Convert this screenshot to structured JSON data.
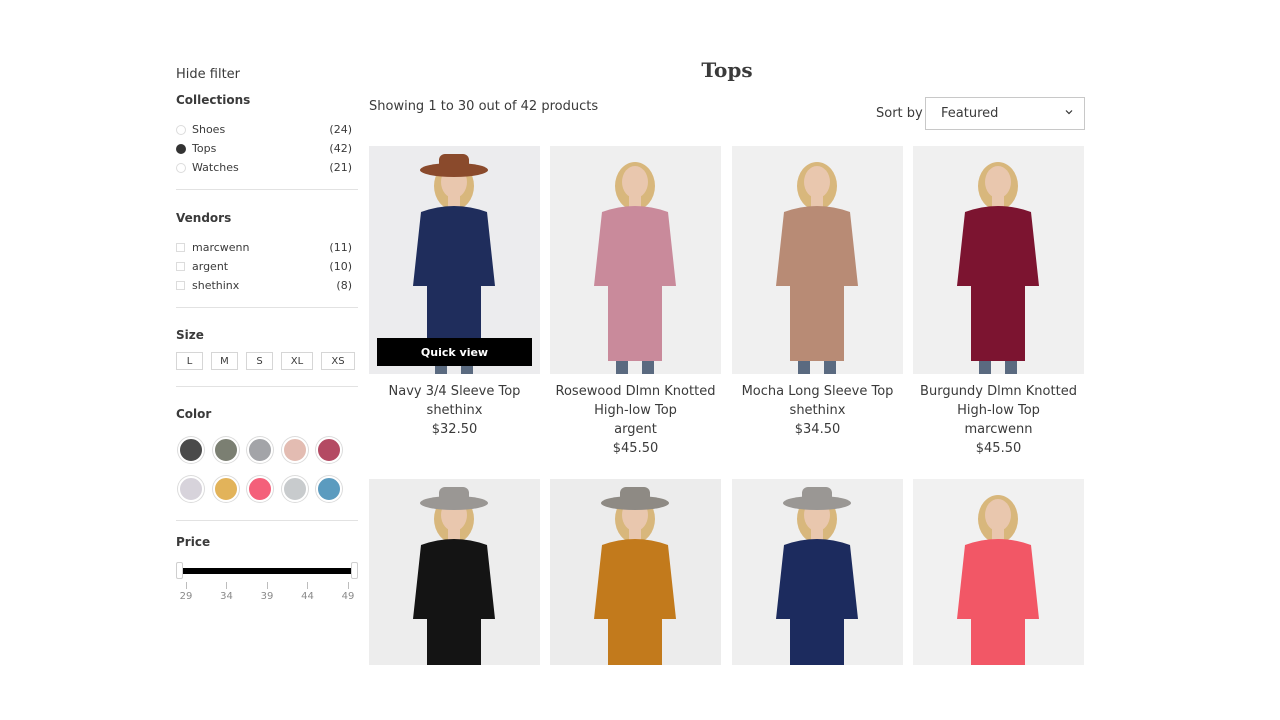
{
  "sidebar": {
    "hide_filter": "Hide filter",
    "collections": {
      "title": "Collections",
      "items": [
        {
          "label": "Shoes",
          "count": "(24)",
          "selected": false
        },
        {
          "label": "Tops",
          "count": "(42)",
          "selected": true
        },
        {
          "label": "Watches",
          "count": "(21)",
          "selected": false
        }
      ]
    },
    "vendors": {
      "title": "Vendors",
      "items": [
        {
          "label": "marcwenn",
          "count": "(11)"
        },
        {
          "label": "argent",
          "count": "(10)"
        },
        {
          "label": "shethinx",
          "count": "(8)"
        }
      ]
    },
    "size": {
      "title": "Size",
      "options": [
        "L",
        "M",
        "S",
        "XL",
        "XS"
      ]
    },
    "color": {
      "title": "Color",
      "swatches": [
        "#4a4a4a",
        "#7b7f72",
        "#a3a4a8",
        "#e3bcb2",
        "#b44a63",
        "#d7d3db",
        "#e2b35a",
        "#f4607a",
        "#c8cbcd",
        "#5b9bbf"
      ]
    },
    "price": {
      "title": "Price",
      "ticks": [
        "29",
        "34",
        "39",
        "44",
        "49"
      ]
    }
  },
  "main": {
    "title": "Tops",
    "showing": "Showing 1 to 30 out of 42 products",
    "sort_label": "Sort by",
    "sort_value": "Featured",
    "quick_view": "Quick view",
    "products": [
      {
        "name_lines": [
          "Navy 3/4 Sleeve Top"
        ],
        "vendor": "shethinx",
        "price": "$32.50",
        "bg": "#ececee",
        "garment": "#1f2d5c",
        "hat": "#8a4a2c"
      },
      {
        "name_lines": [
          "Rosewood Dlmn Knotted",
          "High-low Top"
        ],
        "vendor": "argent",
        "price": "$45.50",
        "bg": "#efefef",
        "garment": "#c98a9b",
        "hat": ""
      },
      {
        "name_lines": [
          "Mocha Long Sleeve Top"
        ],
        "vendor": "shethinx",
        "price": "$34.50",
        "bg": "#f0f0f0",
        "garment": "#b88b75",
        "hat": ""
      },
      {
        "name_lines": [
          "Burgundy Dlmn Knotted",
          "High-low Top"
        ],
        "vendor": "marcwenn",
        "price": "$45.50",
        "bg": "#f0f0f0",
        "garment": "#7c1430",
        "hat": ""
      },
      {
        "bg": "#ededed",
        "garment": "#141414",
        "hat": "#9a9794"
      },
      {
        "bg": "#ececec",
        "garment": "#c27a1c",
        "hat": "#8e8a84"
      },
      {
        "bg": "#efefef",
        "garment": "#1c2b5e",
        "hat": "#9a9794"
      },
      {
        "bg": "#f1f1f1",
        "garment": "#f25766",
        "hat": ""
      }
    ]
  }
}
